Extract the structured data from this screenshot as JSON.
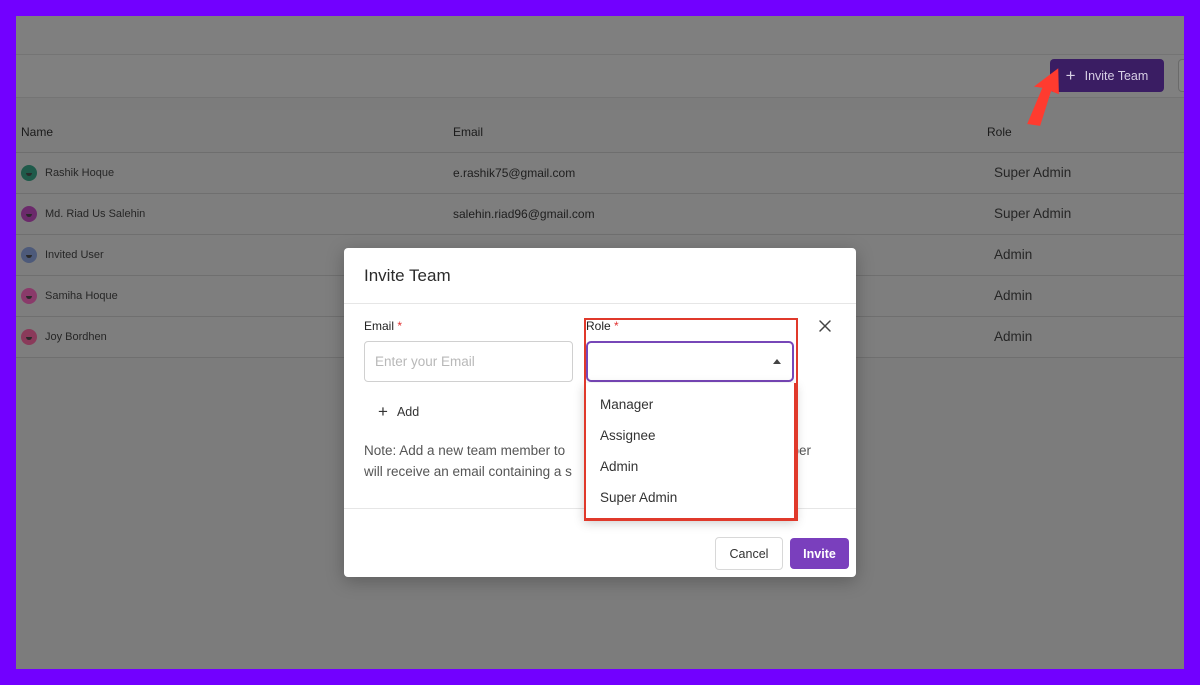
{
  "toolbar": {
    "invite_team_label": "Invite Team"
  },
  "table": {
    "headers": {
      "name": "Name",
      "email": "Email",
      "role": "Role"
    },
    "rows": [
      {
        "name": "Rashik Hoque",
        "email": "e.rashik75@gmail.com",
        "role": "Super Admin",
        "avatar_color": "#1f5a4a"
      },
      {
        "name": "Md. Riad Us Salehin",
        "email": "salehin.riad96@gmail.com",
        "role": "Super Admin",
        "avatar_color": "#6b2a6b"
      },
      {
        "name": "Invited User",
        "email": "",
        "role": "Admin",
        "avatar_color": "#4d5a7a"
      },
      {
        "name": "Samiha Hoque",
        "email": "",
        "role": "Admin",
        "avatar_color": "#8a3a6a"
      },
      {
        "name": "Joy Bordhen",
        "email": "",
        "role": "Admin",
        "avatar_color": "#8a3a5a"
      }
    ]
  },
  "modal": {
    "title": "Invite Team",
    "email_label": "Email",
    "role_label": "Role",
    "required_mark": "*",
    "email_placeholder": "Enter your Email",
    "add_label": "Add",
    "note_line1": "Note: Add a new team member to",
    "note_line1_end": "nber",
    "note_line2": "will receive an email containing a s",
    "cancel_label": "Cancel",
    "invite_label": "Invite"
  },
  "dropdown": {
    "options": [
      "Manager",
      "Assignee",
      "Admin",
      "Super Admin"
    ]
  },
  "colors": {
    "backdrop": "#7200ff",
    "accent": "#7a3fbd",
    "highlight": "#e0392b"
  }
}
